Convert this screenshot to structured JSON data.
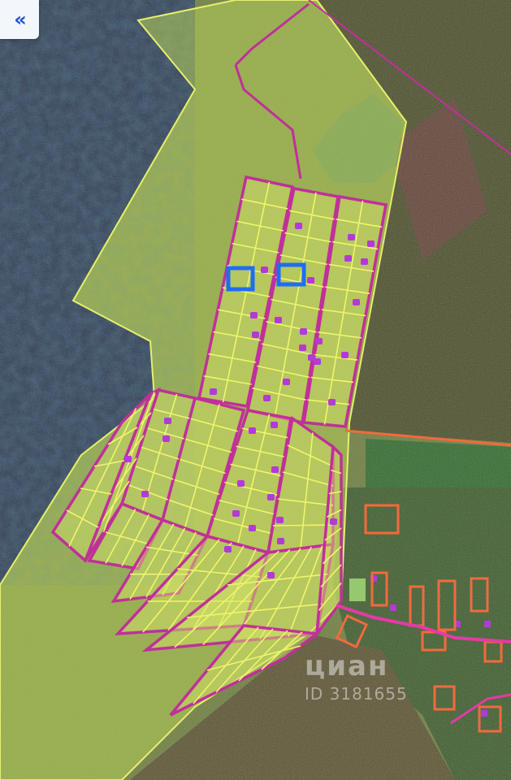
{
  "toolbar": {
    "back_icon": "double-chevron-left-icon",
    "back_label": "«"
  },
  "watermark": {
    "logo": "циан",
    "id_text": "ID 3181655"
  },
  "colors": {
    "parcel_fill": "#d8e66a",
    "parcel_line": "#f0f56a",
    "boundary": "#c0309a",
    "selected": "#1f6cf5",
    "house": "#b33ad6",
    "village_lot": "#f26a3c",
    "road": "#e53aa6"
  }
}
